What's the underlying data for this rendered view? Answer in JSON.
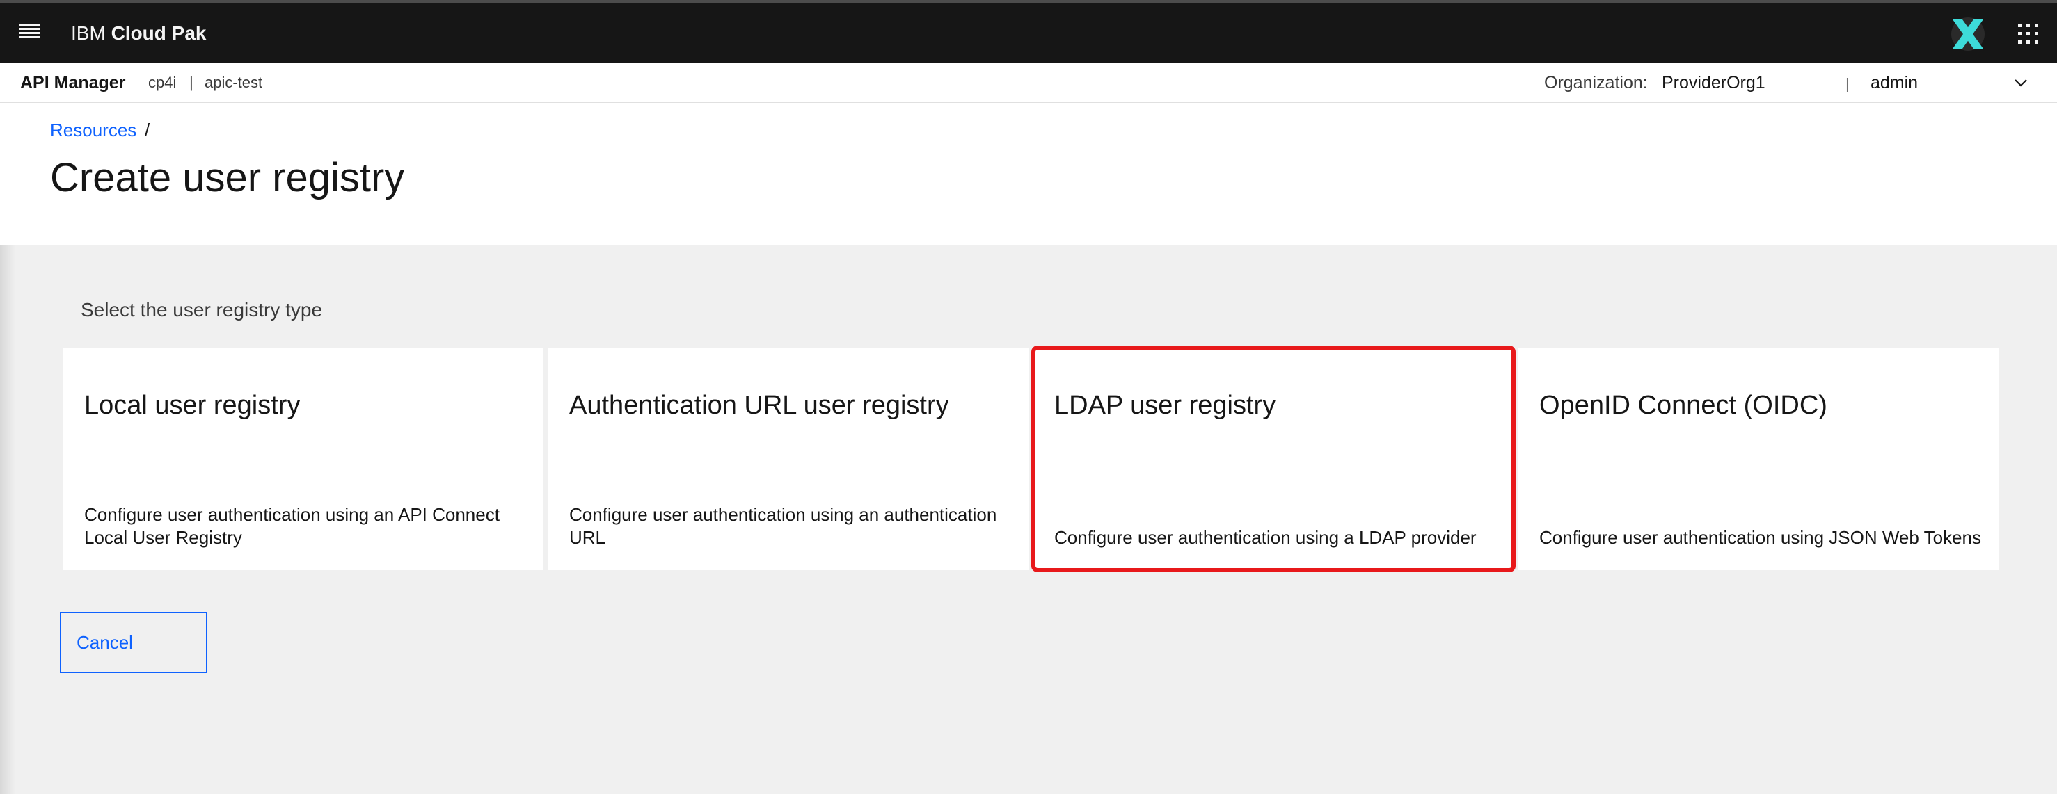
{
  "header": {
    "brand_light": "IBM",
    "brand_bold": "Cloud Pak"
  },
  "subheader": {
    "product": "API Manager",
    "instance": "cp4i",
    "separator": "|",
    "namespace": "apic-test",
    "org_label": "Organization:",
    "org_value": "ProviderOrg1",
    "user_separator": "|",
    "user": "admin"
  },
  "breadcrumb": {
    "link": "Resources",
    "separator": "/"
  },
  "page": {
    "title": "Create user registry"
  },
  "content": {
    "prompt": "Select the user registry type",
    "tiles": [
      {
        "title": "Local user registry",
        "description": "Configure user authentication using an API Connect Local User Registry"
      },
      {
        "title": "Authentication URL user registry",
        "description": "Configure user authentication using an authentication URL"
      },
      {
        "title": "LDAP user registry",
        "description": "Configure user authentication using a LDAP provider"
      },
      {
        "title": "OpenID Connect (OIDC)",
        "description": "Configure user authentication using JSON Web Tokens"
      }
    ],
    "cancel_label": "Cancel"
  },
  "colors": {
    "topbar": "#161616",
    "link": "#0f62fe",
    "highlight": "#e8191b",
    "logo": "#3ddbd9",
    "content_bg": "#f0f0f0"
  },
  "icons": [
    "hamburger-menu-icon",
    "cloud-pak-logo-icon",
    "app-switcher-icon",
    "chevron-down-icon"
  ]
}
